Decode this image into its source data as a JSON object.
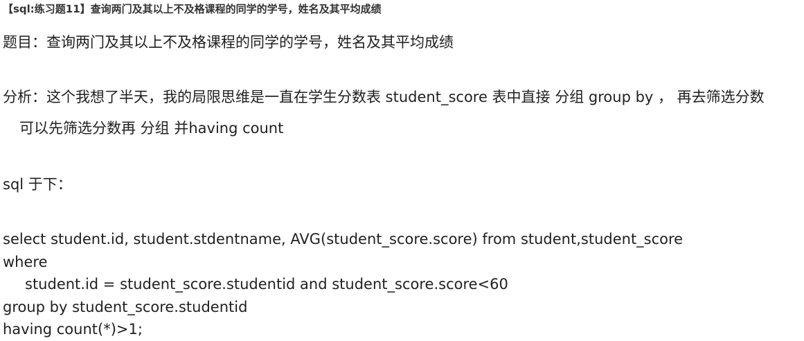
{
  "title": "【sql:练习题11】查询两门及其以上不及格课程的同学的学号，姓名及其平均成绩",
  "question": "题目：查询两门及其以上不及格课程的同学的学号，姓名及其平均成绩",
  "analysis": {
    "line1": "分析：这个我想了半天，我的局限思维是一直在学生分数表 student_score 表中直接 分组 group by ， 再去筛选分数",
    "line2": "可以先筛选分数再 分组 并having count"
  },
  "sql_label": "sql 于下：",
  "code": {
    "line1": "select student.id, student.stdentname, AVG(student_score.score) from student,student_score",
    "line2": "where",
    "line3": "student.id = student_score.studentid and student_score.score<60",
    "line4": "group by student_score.studentid",
    "line5": "having count(*)>1;"
  }
}
